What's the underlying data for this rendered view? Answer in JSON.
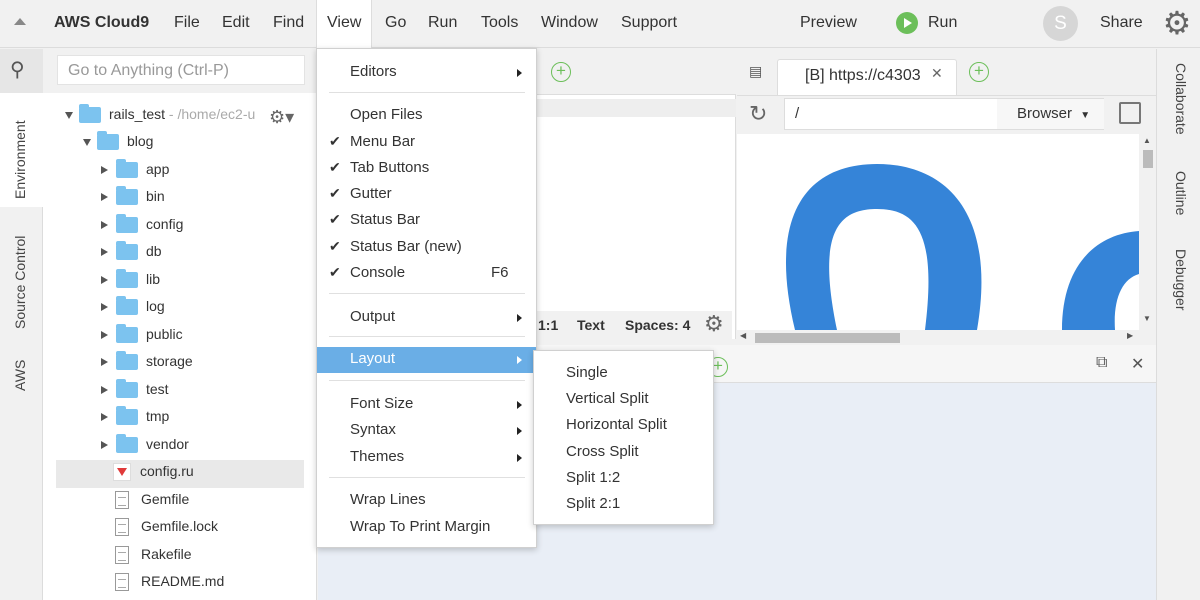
{
  "menubar": {
    "brand": "AWS Cloud9",
    "menus": [
      "File",
      "Edit",
      "Find",
      "View",
      "Go",
      "Run",
      "Tools",
      "Window",
      "Support"
    ],
    "preview": "Preview",
    "run": "Run",
    "avatar_initial": "S",
    "share": "Share"
  },
  "left_tabs": [
    "Environment",
    "Source Control",
    "AWS"
  ],
  "right_tabs": [
    "Collaborate",
    "Outline",
    "Debugger"
  ],
  "search": {
    "placeholder": "Go to Anything (Ctrl-P)"
  },
  "tree": {
    "root_name": "rails_test",
    "root_path": " - /home/ec2-u",
    "project": "blog",
    "folders": [
      "app",
      "bin",
      "config",
      "db",
      "lib",
      "log",
      "public",
      "storage",
      "test",
      "tmp",
      "vendor"
    ],
    "files": [
      "config.ru",
      "Gemfile",
      "Gemfile.lock",
      "Rakefile",
      "README.md"
    ]
  },
  "editor": {
    "status_position": "1:1",
    "status_mode": "Text",
    "status_spaces": "Spaces: 4"
  },
  "browser": {
    "tab_title": "[B] https://c4303",
    "url": "/",
    "mode": "Browser"
  },
  "view_menu": {
    "editors": "Editors",
    "open_files": "Open Files",
    "menu_bar": "Menu Bar",
    "tab_buttons": "Tab Buttons",
    "gutter": "Gutter",
    "status_bar": "Status Bar",
    "status_bar_new": "Status Bar (new)",
    "console": "Console",
    "console_shortcut": "F6",
    "output": "Output",
    "layout": "Layout",
    "font_size": "Font Size",
    "syntax": "Syntax",
    "themes": "Themes",
    "wrap_lines": "Wrap Lines",
    "wrap_to_print_margin": "Wrap To Print Margin"
  },
  "layout_menu": [
    "Single",
    "Vertical Split",
    "Horizontal Split",
    "Cross Split",
    "Split 1:2",
    "Split 2:1"
  ],
  "colors": {
    "accent": "#6aaee6",
    "run_green": "#6cbf5a",
    "folder_blue": "#7cc3ef",
    "logo_blue": "#3584d8",
    "console_bg": "#e9eef6"
  }
}
